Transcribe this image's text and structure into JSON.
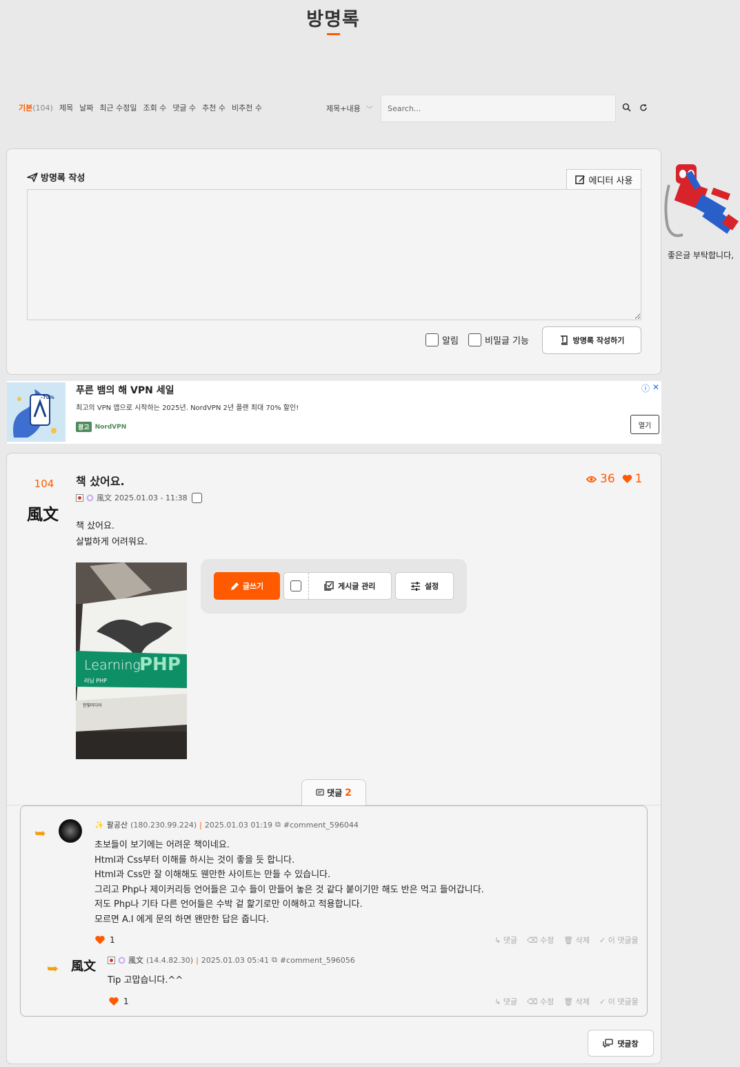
{
  "page": {
    "title": "방명록"
  },
  "sort": {
    "items": [
      {
        "label": "기본",
        "count": "(104)",
        "active": true
      },
      {
        "label": "제목"
      },
      {
        "label": "날짜"
      },
      {
        "label": "최근 수정일"
      },
      {
        "label": "조회 수"
      },
      {
        "label": "댓글 수"
      },
      {
        "label": "추천 수"
      },
      {
        "label": "비추천 수"
      }
    ]
  },
  "search": {
    "scope": "제목+내용",
    "placeholder": "Search..."
  },
  "write": {
    "heading": "방명록 작성",
    "editor_label": "에디터 사용",
    "notify_label": "알림",
    "secret_label": "비밀글 기능",
    "submit_label": "방명록 작성하기"
  },
  "sidebar": {
    "caption": "좋은글 부탁합니다,"
  },
  "ad": {
    "title": "푸른 뱀의 해 VPN 세일",
    "desc": "최고의 VPN 앱으로 시작하는 2025년. NordVPN 2년 플랜 최대 70% 할인!",
    "tag": "광고",
    "brand": "NordVPN",
    "open_label": "열기",
    "badge": "-70%"
  },
  "post": {
    "number": "104",
    "title": "책 샀어요.",
    "author": "風文",
    "date": "2025.01.03 - 11:38",
    "views": "36",
    "likes": "1",
    "body_line1": "책 샀어요.",
    "body_line2": "살벌하게 어려워요.",
    "image": {
      "book_title_1": "Learning",
      "book_title_2": "PHP",
      "book_sub": "러닝 PHP",
      "publisher": "한빛미디어"
    }
  },
  "toolbar": {
    "write_label": "글쓰기",
    "manage_label": "게시글 관리",
    "settings_label": "설정"
  },
  "comments_tab": {
    "label": "댓글",
    "count": "2"
  },
  "comments": [
    {
      "author": "팔공산",
      "ip": "(180.230.99.224)",
      "date": "2025.01.03 01:19",
      "anchor": "#comment_596044",
      "lines": [
        "초보들이 보기에는 어려운 책이네요.",
        "Html과 Css부터 이해를 하시는 것이 좋을 듯 합니다.",
        "Html과 Css만 잘 이해해도 웬만한 사이트는 만들 수 있습니다.",
        "그리고 Php나 제이커리등 언어들은 고수 들이 만들어 놓은 것 같다 붙이기만 해도 반은 먹고 들어갑니다.",
        "저도 Php나 기타 다른 언어들은 수박 겉 핥기로만 이해하고 적용합니다.",
        "모르면 A.I 에게 문의 하면 왠만한 답은 줍니다."
      ],
      "likes": "1"
    },
    {
      "author": "風文",
      "ip": "(14.4.82.30)",
      "date": "2025.01.03 05:41",
      "anchor": "#comment_596056",
      "lines": [
        "Tip 고맙습니다.^^"
      ],
      "likes": "1"
    }
  ],
  "comment_actions": {
    "reply": "댓글",
    "edit": "수정",
    "delete": "삭제",
    "this": "이 댓글을"
  },
  "bottom": {
    "button_label": "댓글창"
  },
  "colors": {
    "accent": "#ff5a00",
    "arrow": "#f0a010"
  }
}
